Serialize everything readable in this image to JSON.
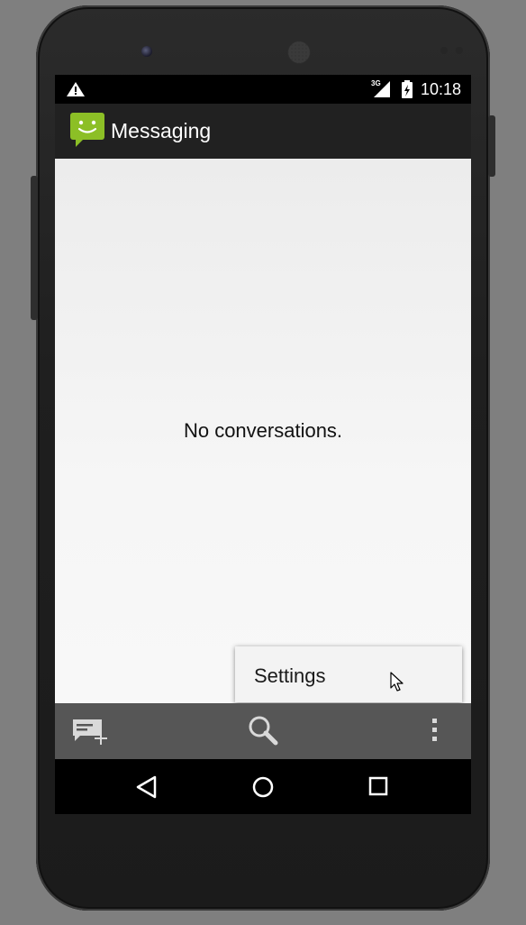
{
  "device": {
    "side_buttons": [
      "left-volume",
      "right-power"
    ]
  },
  "status_bar": {
    "time": "10:18",
    "network_label": "3G",
    "icons": [
      "warning-icon",
      "signal-icon",
      "battery-icon"
    ]
  },
  "action_bar": {
    "title": "Messaging",
    "app_icon": "messaging-app-icon",
    "icon_color": "#8cbf26"
  },
  "content": {
    "empty_text": "No conversations."
  },
  "overflow_menu": {
    "items": [
      {
        "label": "Settings"
      }
    ]
  },
  "bottom_bar": {
    "actions": [
      "compose-new-icon",
      "search-icon",
      "overflow-menu-icon"
    ]
  },
  "nav_bar": {
    "buttons": [
      "back",
      "home",
      "recent-apps"
    ]
  }
}
